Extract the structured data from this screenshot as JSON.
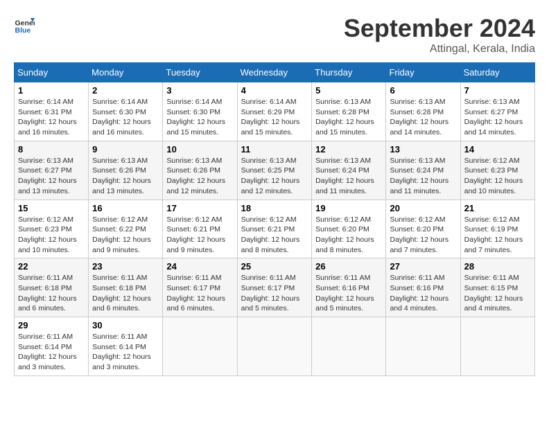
{
  "logo": {
    "line1": "General",
    "line2": "Blue"
  },
  "title": "September 2024",
  "subtitle": "Attingal, Kerala, India",
  "days_header": [
    "Sunday",
    "Monday",
    "Tuesday",
    "Wednesday",
    "Thursday",
    "Friday",
    "Saturday"
  ],
  "weeks": [
    [
      {
        "day": "1",
        "sunrise": "6:14 AM",
        "sunset": "6:31 PM",
        "daylight": "12 hours and 16 minutes."
      },
      {
        "day": "2",
        "sunrise": "6:14 AM",
        "sunset": "6:30 PM",
        "daylight": "12 hours and 16 minutes."
      },
      {
        "day": "3",
        "sunrise": "6:14 AM",
        "sunset": "6:30 PM",
        "daylight": "12 hours and 15 minutes."
      },
      {
        "day": "4",
        "sunrise": "6:14 AM",
        "sunset": "6:29 PM",
        "daylight": "12 hours and 15 minutes."
      },
      {
        "day": "5",
        "sunrise": "6:13 AM",
        "sunset": "6:28 PM",
        "daylight": "12 hours and 15 minutes."
      },
      {
        "day": "6",
        "sunrise": "6:13 AM",
        "sunset": "6:28 PM",
        "daylight": "12 hours and 14 minutes."
      },
      {
        "day": "7",
        "sunrise": "6:13 AM",
        "sunset": "6:27 PM",
        "daylight": "12 hours and 14 minutes."
      }
    ],
    [
      {
        "day": "8",
        "sunrise": "6:13 AM",
        "sunset": "6:27 PM",
        "daylight": "12 hours and 13 minutes."
      },
      {
        "day": "9",
        "sunrise": "6:13 AM",
        "sunset": "6:26 PM",
        "daylight": "12 hours and 13 minutes."
      },
      {
        "day": "10",
        "sunrise": "6:13 AM",
        "sunset": "6:26 PM",
        "daylight": "12 hours and 12 minutes."
      },
      {
        "day": "11",
        "sunrise": "6:13 AM",
        "sunset": "6:25 PM",
        "daylight": "12 hours and 12 minutes."
      },
      {
        "day": "12",
        "sunrise": "6:13 AM",
        "sunset": "6:24 PM",
        "daylight": "12 hours and 11 minutes."
      },
      {
        "day": "13",
        "sunrise": "6:13 AM",
        "sunset": "6:24 PM",
        "daylight": "12 hours and 11 minutes."
      },
      {
        "day": "14",
        "sunrise": "6:12 AM",
        "sunset": "6:23 PM",
        "daylight": "12 hours and 10 minutes."
      }
    ],
    [
      {
        "day": "15",
        "sunrise": "6:12 AM",
        "sunset": "6:23 PM",
        "daylight": "12 hours and 10 minutes."
      },
      {
        "day": "16",
        "sunrise": "6:12 AM",
        "sunset": "6:22 PM",
        "daylight": "12 hours and 9 minutes."
      },
      {
        "day": "17",
        "sunrise": "6:12 AM",
        "sunset": "6:21 PM",
        "daylight": "12 hours and 9 minutes."
      },
      {
        "day": "18",
        "sunrise": "6:12 AM",
        "sunset": "6:21 PM",
        "daylight": "12 hours and 8 minutes."
      },
      {
        "day": "19",
        "sunrise": "6:12 AM",
        "sunset": "6:20 PM",
        "daylight": "12 hours and 8 minutes."
      },
      {
        "day": "20",
        "sunrise": "6:12 AM",
        "sunset": "6:20 PM",
        "daylight": "12 hours and 7 minutes."
      },
      {
        "day": "21",
        "sunrise": "6:12 AM",
        "sunset": "6:19 PM",
        "daylight": "12 hours and 7 minutes."
      }
    ],
    [
      {
        "day": "22",
        "sunrise": "6:11 AM",
        "sunset": "6:18 PM",
        "daylight": "12 hours and 6 minutes."
      },
      {
        "day": "23",
        "sunrise": "6:11 AM",
        "sunset": "6:18 PM",
        "daylight": "12 hours and 6 minutes."
      },
      {
        "day": "24",
        "sunrise": "6:11 AM",
        "sunset": "6:17 PM",
        "daylight": "12 hours and 6 minutes."
      },
      {
        "day": "25",
        "sunrise": "6:11 AM",
        "sunset": "6:17 PM",
        "daylight": "12 hours and 5 minutes."
      },
      {
        "day": "26",
        "sunrise": "6:11 AM",
        "sunset": "6:16 PM",
        "daylight": "12 hours and 5 minutes."
      },
      {
        "day": "27",
        "sunrise": "6:11 AM",
        "sunset": "6:16 PM",
        "daylight": "12 hours and 4 minutes."
      },
      {
        "day": "28",
        "sunrise": "6:11 AM",
        "sunset": "6:15 PM",
        "daylight": "12 hours and 4 minutes."
      }
    ],
    [
      {
        "day": "29",
        "sunrise": "6:11 AM",
        "sunset": "6:14 PM",
        "daylight": "12 hours and 3 minutes."
      },
      {
        "day": "30",
        "sunrise": "6:11 AM",
        "sunset": "6:14 PM",
        "daylight": "12 hours and 3 minutes."
      },
      null,
      null,
      null,
      null,
      null
    ]
  ]
}
